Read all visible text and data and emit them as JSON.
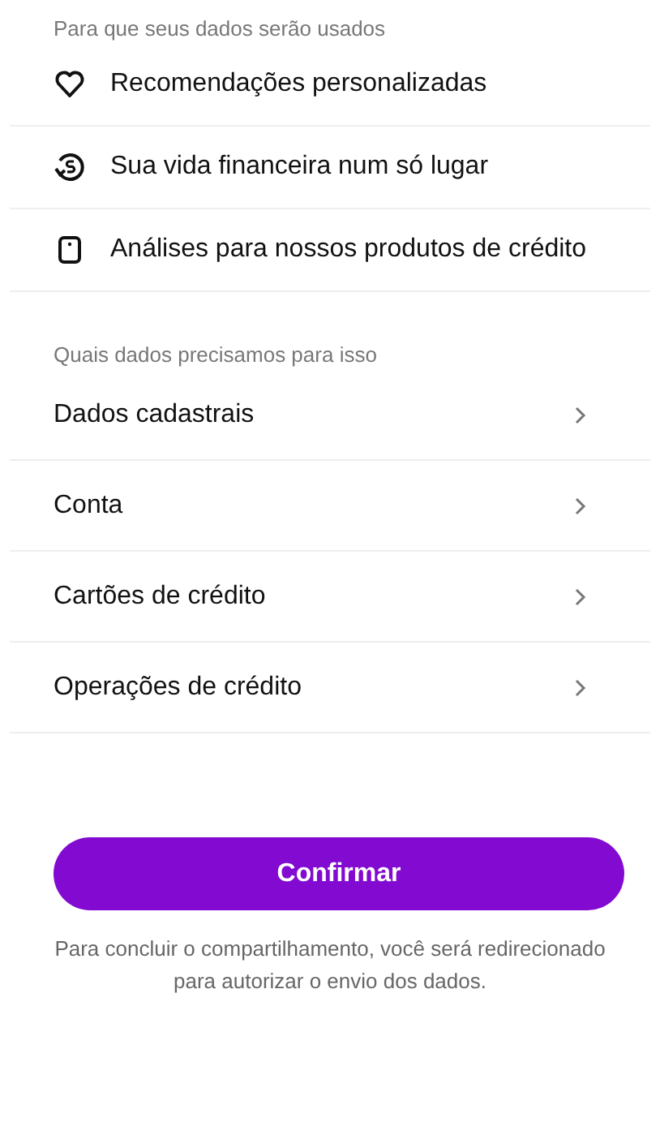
{
  "purposes": {
    "heading": "Para que seus dados serão usados",
    "items": [
      "Recomendações personalizadas",
      "Sua vida financeira num só lugar",
      "Análises para nossos produtos de crédito"
    ]
  },
  "data_needed": {
    "heading": "Quais dados precisamos para isso",
    "items": [
      "Dados cadastrais",
      "Conta",
      "Cartões de crédito",
      "Operações de crédito"
    ]
  },
  "confirm_button": "Confirmar",
  "footnote": "Para concluir o compartilhamento, você será redirecionado para autorizar o envio dos dados."
}
